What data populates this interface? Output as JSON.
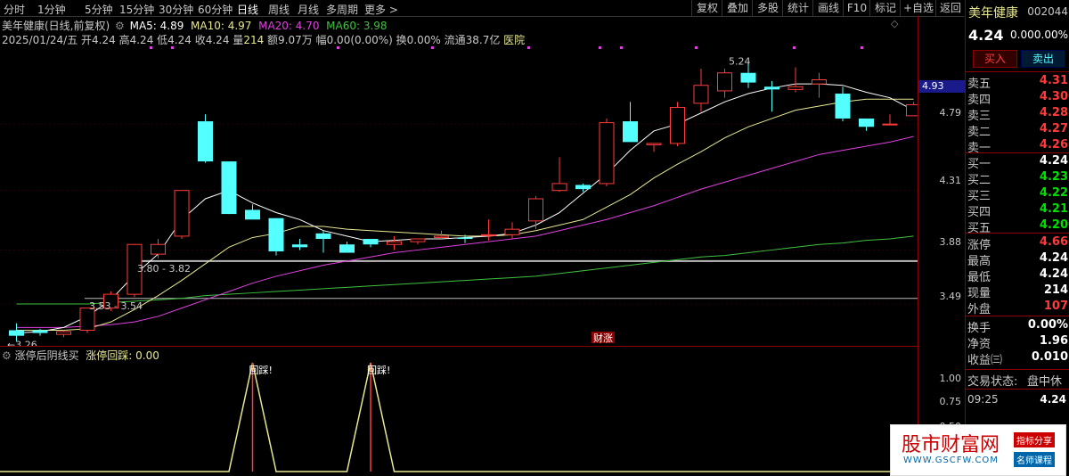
{
  "timeframes": [
    "分时",
    "1分钟",
    "5分钟",
    "15分钟",
    "30分钟",
    "60分钟",
    "日线",
    "周线",
    "月线",
    "多周期",
    "更多 >"
  ],
  "active_timeframe": "日线",
  "toolbar_right": [
    "复权",
    "叠加",
    "多股",
    "统计",
    "画线",
    "F10",
    "标记",
    "+自选",
    "返回"
  ],
  "stock": {
    "name": "美年健康",
    "code": "002044",
    "price": "4.24",
    "change": "0.00",
    "change_pct": "0.00%"
  },
  "ma_line": {
    "title": "美年健康(日线,前复权)",
    "ma5": "MA5: 4.89",
    "ma10": "MA10: 4.97",
    "ma20": "MA20: 4.70",
    "ma60": "MA60: 3.98"
  },
  "info_line": {
    "date": "2025/01/24/五",
    "open": "开4.24",
    "high": "高4.24",
    "low": "低4.24",
    "close": "收4.24",
    "vol_label": "量",
    "vol": "214",
    "amount": "额9.07万",
    "amp": "幅0.00(0.00%)",
    "turnover": "换0.00%",
    "float": "流通38.7亿",
    "sector": "医院"
  },
  "price_axis": [
    "4.79",
    "4.31",
    "3.88",
    "3.49"
  ],
  "price_tag": "4.93",
  "annotations": {
    "high": "5.24",
    "low": "3.26",
    "gap1": "3.80 - 3.82",
    "gap2": "3.53 - 3.54",
    "marker": "财涨"
  },
  "indicator": {
    "name": "涨停后阴线买",
    "sub_label": "涨停回踩:",
    "sub_value": "0.00",
    "axis": [
      "1.00",
      "0.75",
      "0.50"
    ],
    "signal": "回踩!"
  },
  "sell_side": [
    {
      "label": "卖五",
      "price": "4.31"
    },
    {
      "label": "卖四",
      "price": "4.30"
    },
    {
      "label": "卖三",
      "price": "4.28"
    },
    {
      "label": "卖二",
      "price": "4.27"
    },
    {
      "label": "卖一",
      "price": "4.26"
    }
  ],
  "buy_side": [
    {
      "label": "买一",
      "price": "4.24"
    },
    {
      "label": "买二",
      "price": "4.23"
    },
    {
      "label": "买三",
      "price": "4.22"
    },
    {
      "label": "买四",
      "price": "4.21"
    },
    {
      "label": "买五",
      "price": "4.20"
    }
  ],
  "stats1": [
    {
      "label": "涨停",
      "value": "4.66"
    },
    {
      "label": "最高",
      "value": "4.24"
    },
    {
      "label": "最低",
      "value": "4.24"
    },
    {
      "label": "现量",
      "value": "214"
    },
    {
      "label": "外盘",
      "value": "107"
    }
  ],
  "stats2": [
    {
      "label": "换手",
      "value": "0.00%"
    },
    {
      "label": "净资",
      "value": "1.96"
    },
    {
      "label": "收益㈢",
      "value": "0.010"
    }
  ],
  "trade_state": {
    "label": "交易状态:",
    "value": "盘中休"
  },
  "last_tick": {
    "time": "09:25",
    "price": "4.24"
  },
  "buttons": {
    "buy": "买入",
    "sell": "卖出"
  },
  "watermark": {
    "title": "股市财富网",
    "url": "WWW.GSCFW.COM",
    "tag1": "指标分享",
    "tag2": "名师课程"
  },
  "colors": {
    "up": "#ff3b3b",
    "down": "#54ffff",
    "ma5": "#ffffff",
    "ma10": "#e8e890",
    "ma20": "#e040e0",
    "ma60": "#40c040"
  },
  "chart_data": {
    "type": "candlestick",
    "ohlc": [
      [
        3.3,
        3.35,
        3.22,
        3.26
      ],
      [
        3.3,
        3.31,
        3.26,
        3.28
      ],
      [
        3.27,
        3.3,
        3.25,
        3.29
      ],
      [
        3.3,
        3.46,
        3.28,
        3.46
      ],
      [
        3.46,
        3.58,
        3.44,
        3.56
      ],
      [
        3.56,
        3.92,
        3.54,
        3.92
      ],
      [
        3.85,
        3.96,
        3.82,
        3.92
      ],
      [
        3.98,
        4.31,
        3.96,
        4.31
      ],
      [
        4.81,
        4.86,
        4.51,
        4.52
      ],
      [
        4.52,
        4.52,
        4.14,
        4.14
      ],
      [
        4.17,
        4.21,
        4.12,
        4.1
      ],
      [
        4.11,
        4.11,
        3.84,
        3.87
      ],
      [
        3.92,
        3.96,
        3.88,
        3.9
      ],
      [
        4.0,
        4.02,
        3.86,
        3.96
      ],
      [
        3.92,
        3.94,
        3.86,
        3.86
      ],
      [
        3.96,
        3.96,
        3.9,
        3.92
      ],
      [
        3.92,
        3.98,
        3.88,
        3.94
      ],
      [
        3.94,
        3.96,
        3.92,
        3.96
      ],
      [
        3.97,
        4.02,
        3.96,
        3.98
      ],
      [
        3.97,
        3.99,
        3.93,
        3.96
      ],
      [
        3.99,
        4.1,
        3.95,
        3.99
      ],
      [
        3.99,
        4.08,
        3.96,
        4.03
      ],
      [
        4.09,
        4.27,
        4.03,
        4.25
      ],
      [
        4.31,
        4.55,
        4.3,
        4.36
      ],
      [
        4.35,
        4.36,
        4.3,
        4.32
      ],
      [
        4.36,
        4.83,
        4.34,
        4.8
      ],
      [
        4.81,
        4.95,
        4.66,
        4.66
      ],
      [
        4.64,
        4.65,
        4.59,
        4.65
      ],
      [
        4.65,
        4.95,
        4.63,
        4.91
      ],
      [
        4.94,
        5.19,
        4.88,
        5.07
      ],
      [
        5.03,
        5.19,
        4.98,
        5.16
      ],
      [
        5.16,
        5.24,
        5.05,
        5.09
      ],
      [
        5.06,
        5.1,
        4.88,
        5.04
      ],
      [
        5.04,
        5.2,
        5.02,
        5.06
      ],
      [
        5.08,
        5.16,
        4.98,
        5.11
      ],
      [
        5.01,
        5.06,
        4.81,
        4.83
      ],
      [
        4.83,
        4.83,
        4.74,
        4.77
      ],
      [
        4.79,
        4.86,
        4.79,
        4.79
      ],
      [
        4.85,
        4.95,
        4.85,
        4.93
      ]
    ],
    "ma5": [
      3.28,
      3.29,
      3.32,
      3.4,
      3.52,
      3.7,
      3.85,
      4.1,
      4.25,
      4.31,
      4.22,
      4.15,
      4.1,
      4.02,
      3.98,
      3.94,
      3.95,
      3.96,
      3.96,
      3.97,
      3.98,
      4.0,
      4.06,
      4.15,
      4.29,
      4.43,
      4.6,
      4.74,
      4.79,
      4.87,
      4.95,
      5.01,
      5.05,
      5.08,
      5.08,
      5.07,
      5.02,
      4.98,
      4.89
    ],
    "ma10": [
      3.3,
      3.3,
      3.3,
      3.31,
      3.36,
      3.45,
      3.55,
      3.66,
      3.78,
      3.9,
      3.97,
      4.0,
      4.05,
      4.05,
      4.03,
      4.02,
      4.01,
      4.0,
      3.99,
      3.98,
      3.98,
      3.99,
      4.02,
      4.06,
      4.1,
      4.19,
      4.28,
      4.4,
      4.5,
      4.59,
      4.69,
      4.77,
      4.83,
      4.89,
      4.92,
      4.95,
      4.97,
      4.97,
      4.97
    ],
    "ma20": [
      3.32,
      3.32,
      3.32,
      3.33,
      3.34,
      3.36,
      3.4,
      3.46,
      3.52,
      3.58,
      3.64,
      3.69,
      3.73,
      3.77,
      3.8,
      3.83,
      3.86,
      3.88,
      3.9,
      3.92,
      3.94,
      3.96,
      3.98,
      4.02,
      4.06,
      4.1,
      4.15,
      4.2,
      4.26,
      4.32,
      4.37,
      4.42,
      4.47,
      4.52,
      4.57,
      4.6,
      4.63,
      4.66,
      4.7
    ],
    "ma60": [
      3.49,
      3.49,
      3.49,
      3.49,
      3.5,
      3.51,
      3.52,
      3.53,
      3.55,
      3.56,
      3.57,
      3.58,
      3.59,
      3.6,
      3.61,
      3.62,
      3.63,
      3.64,
      3.65,
      3.66,
      3.67,
      3.68,
      3.69,
      3.71,
      3.73,
      3.75,
      3.77,
      3.79,
      3.81,
      3.83,
      3.84,
      3.86,
      3.88,
      3.9,
      3.92,
      3.93,
      3.95,
      3.96,
      3.98
    ],
    "signal": [
      0,
      0,
      0,
      0,
      0,
      0,
      0,
      0,
      0,
      0,
      1,
      0,
      0,
      0,
      0,
      1,
      0,
      0,
      0,
      0,
      0,
      0,
      0,
      0,
      0,
      0,
      0,
      0,
      0,
      0,
      0,
      0,
      0,
      0,
      0,
      0,
      0,
      0,
      0
    ],
    "ylim": [
      3.2,
      5.3
    ]
  }
}
